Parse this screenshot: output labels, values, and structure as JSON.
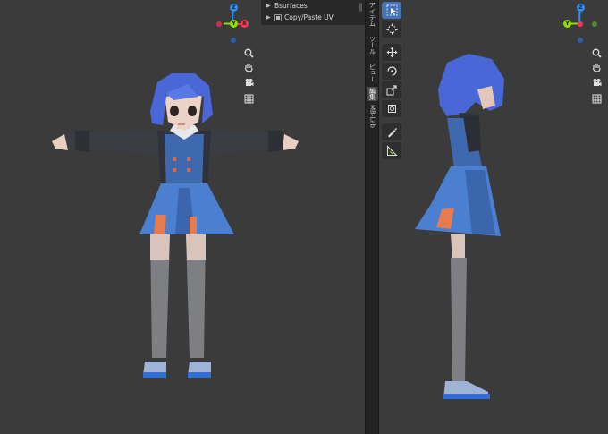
{
  "addons": {
    "items": [
      {
        "label": "Bsurfaces",
        "has_checkbox": false
      },
      {
        "label": "Copy/Paste UV",
        "has_checkbox": true
      }
    ]
  },
  "sidebar_tabs": [
    "アイテム",
    "ツール",
    "ビュー",
    "編集",
    "MB-Lab"
  ],
  "active_sidebar_tab": "編集",
  "gizmo": {
    "x_label": "X",
    "y_label": "Y",
    "z_label": "Z"
  },
  "colors": {
    "x_axis": "#ff3352",
    "y_axis": "#8bdc00",
    "z_axis": "#2890ff",
    "active_tool": "#4772b3",
    "viewport_bg": "#3b3b3b"
  },
  "nav_icons": [
    "zoom-icon",
    "pan-hand-icon",
    "camera-icon",
    "grid-icon"
  ],
  "tools": [
    "select-box-icon",
    "cursor-icon",
    "move-icon",
    "rotate-icon",
    "scale-icon",
    "transform-icon",
    "annotate-icon",
    "measure-icon"
  ]
}
